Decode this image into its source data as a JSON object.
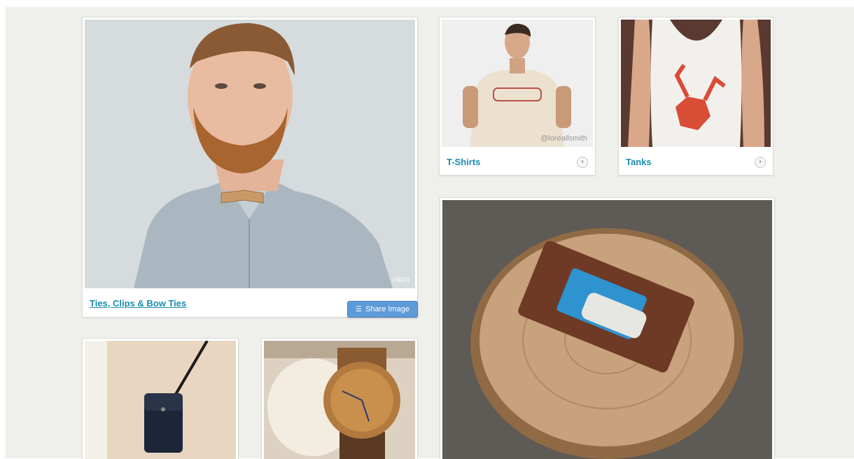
{
  "cards": {
    "ties": {
      "label": "Ties, Clips & Bow Ties",
      "watermark": "rison"
    },
    "tshirts": {
      "label": "T-Shirts",
      "watermark": "@loreallsmith"
    },
    "tanks": {
      "label": "Tanks",
      "watermark": ""
    }
  },
  "share_button": {
    "label": "Share Image",
    "icon": "share-icon"
  },
  "colors": {
    "link": "#1a8cb0",
    "button": "#5d9ad8",
    "background": "#efefeb"
  }
}
